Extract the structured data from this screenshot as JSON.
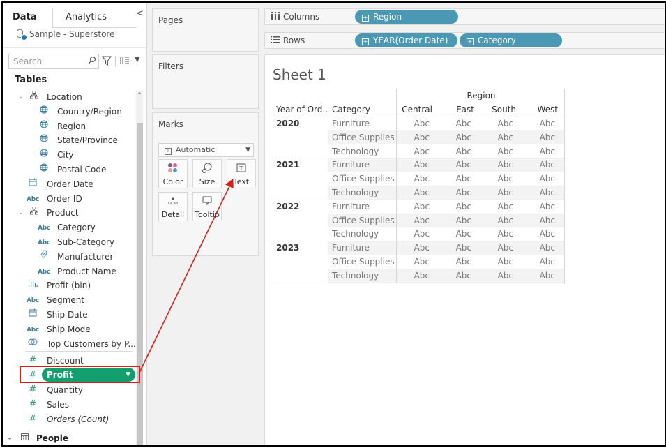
{
  "data_pane": {
    "tabs": [
      {
        "label": "Data",
        "active": true
      },
      {
        "label": "Analytics",
        "active": false
      }
    ],
    "collapse_glyph": "<",
    "datasource": "Sample - Superstore",
    "search_placeholder": "Search",
    "tables_heading": "Tables",
    "fields": [
      {
        "label": "Location",
        "icon": "hierarchy-icon",
        "indent": 1,
        "expanded": true
      },
      {
        "label": "Country/Region",
        "icon": "globe-icon",
        "indent": 2
      },
      {
        "label": "Region",
        "icon": "globe-icon",
        "indent": 2
      },
      {
        "label": "State/Province",
        "icon": "globe-icon",
        "indent": 2
      },
      {
        "label": "City",
        "icon": "globe-icon",
        "indent": 2
      },
      {
        "label": "Postal Code",
        "icon": "globe-icon",
        "indent": 2
      },
      {
        "label": "Order Date",
        "icon": "calendar-icon",
        "indent": 1
      },
      {
        "label": "Order ID",
        "icon": "abc-icon",
        "indent": 1
      },
      {
        "label": "Product",
        "icon": "hierarchy-icon",
        "indent": 1,
        "expanded": true
      },
      {
        "label": "Category",
        "icon": "abc-icon",
        "indent": 2
      },
      {
        "label": "Sub-Category",
        "icon": "abc-icon",
        "indent": 2
      },
      {
        "label": "Manufacturer",
        "icon": "paperclip-icon",
        "indent": 2
      },
      {
        "label": "Product Name",
        "icon": "abc-icon",
        "indent": 2
      },
      {
        "label": "Profit (bin)",
        "icon": "histogram-icon",
        "indent": 1
      },
      {
        "label": "Segment",
        "icon": "abc-icon",
        "indent": 1
      },
      {
        "label": "Ship Date",
        "icon": "calendar-icon",
        "indent": 1
      },
      {
        "label": "Ship Mode",
        "icon": "abc-icon",
        "indent": 1
      },
      {
        "label": "Top Customers by P...",
        "icon": "set-icon",
        "indent": 1
      },
      {
        "label": "Discount",
        "icon": "measure-icon",
        "indent": 1
      },
      {
        "label": "Profit",
        "icon": "measure-icon",
        "indent": 1,
        "selected": true
      },
      {
        "label": "Quantity",
        "icon": "measure-icon",
        "indent": 1
      },
      {
        "label": "Sales",
        "icon": "measure-icon",
        "indent": 1
      },
      {
        "label": "Orders (Count)",
        "icon": "measure-icon",
        "indent": 1,
        "italic": true
      }
    ],
    "people_table": "People"
  },
  "cards": {
    "pages": "Pages",
    "filters": "Filters",
    "marks": {
      "title": "Marks",
      "mark_type": "Automatic",
      "buttons": [
        "Color",
        "Size",
        "Text",
        "Detail",
        "Tooltip"
      ]
    }
  },
  "shelves": {
    "columns": {
      "label": "Columns",
      "pills": [
        "Region"
      ]
    },
    "rows": {
      "label": "Rows",
      "pills": [
        "YEAR(Order Date)",
        "Category"
      ]
    }
  },
  "view": {
    "sheet_title": "Sheet 1",
    "column_header_group": "Region",
    "row_headers": [
      "Year of Ord..",
      "Category"
    ],
    "columns": [
      "Central",
      "East",
      "South",
      "West"
    ],
    "years": [
      "2020",
      "2021",
      "2022",
      "2023"
    ],
    "categories": [
      "Furniture",
      "Office Supplies",
      "Technology"
    ],
    "cell_placeholder": "Abc"
  },
  "annotation": {
    "color": "#d91e18",
    "from": "Profit field",
    "to": "Text mark button"
  },
  "colors": {
    "pill_blue": "#4b98b5",
    "measure_green": "#14a06e",
    "highlight_red": "#d91e18"
  }
}
